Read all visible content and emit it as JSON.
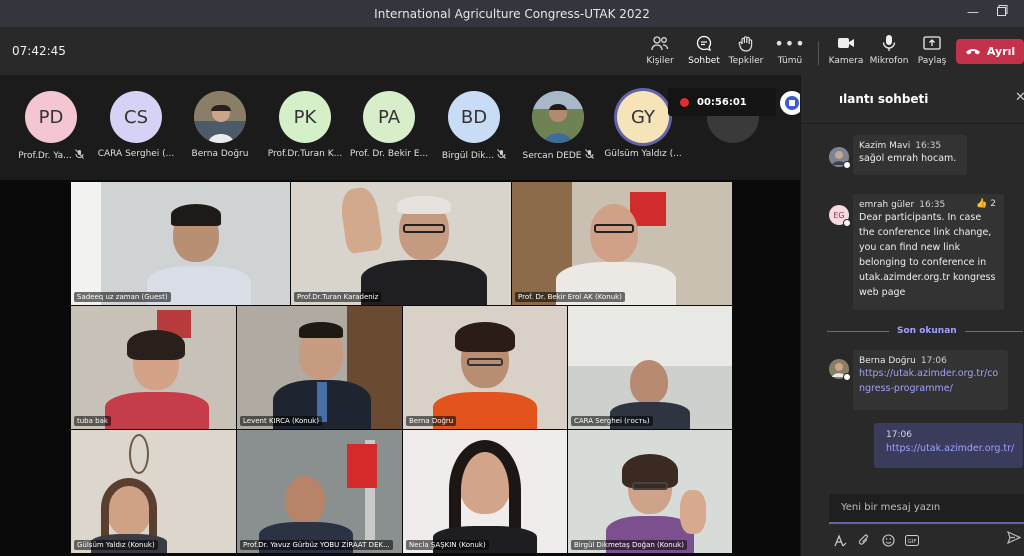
{
  "window": {
    "title": "International Agriculture Congress-UTAK 2022"
  },
  "toolbar": {
    "clock": "07:42:45",
    "people": "Kişiler",
    "chat": "Sohbet",
    "reactions": "Tepkiler",
    "more": "Tümü",
    "camera": "Kamera",
    "mic": "Mikrofon",
    "share": "Paylaş",
    "leave": "Ayrıl"
  },
  "recording": {
    "time": "00:56:01"
  },
  "participants": [
    {
      "initials": "PD",
      "name": "Prof.Dr. Ya...",
      "muted": true,
      "color": "#f3c6d1"
    },
    {
      "initials": "CS",
      "name": "CARA Serghei (...",
      "muted": false,
      "color": "#d6d2f5"
    },
    {
      "initials": "",
      "name": "Berna Doğru",
      "muted": false,
      "color": "#7a6f5a"
    },
    {
      "initials": "PK",
      "name": "Prof.Dr.Turan K...",
      "muted": false,
      "color": "#d5efc9"
    },
    {
      "initials": "PA",
      "name": "Prof. Dr. Bekir E...",
      "muted": false,
      "color": "#d8eecb"
    },
    {
      "initials": "BD",
      "name": "Birgül Dik...",
      "muted": true,
      "color": "#c9dcf6"
    },
    {
      "initials": "",
      "name": "Sercan DEDE",
      "muted": true,
      "color": "#5d6a4a"
    },
    {
      "initials": "GY",
      "name": "Gülsüm Yaldız (...",
      "muted": false,
      "color": "#f6e3b8"
    }
  ],
  "tiles": [
    {
      "label": "Sadeeq uz zaman (Guest)"
    },
    {
      "label": "Prof.Dr.Turan Karadeniz"
    },
    {
      "label": "Prof. Dr. Bekir Erol AK (Konuk)"
    },
    {
      "label": "tuba bak"
    },
    {
      "label": "Levent KIRCA (Konuk)"
    },
    {
      "label": "Berna Doğru"
    },
    {
      "label": "CARA Serghei (гость)"
    },
    {
      "label": "Gülsüm Yaldız (Konuk)"
    },
    {
      "label": "Prof.Dr. Yavuz Gürbüz YOBU ZİRAAT DEK..."
    },
    {
      "label": "Necla ŞAŞKIN (Konuk)"
    },
    {
      "label": "Birgül Dikmetaş Doğan (Konuk)"
    }
  ],
  "chat": {
    "title": "ılantı sohbeti",
    "messages": [
      {
        "author": "Kazim Mavi",
        "time": "16:35",
        "text": "sağol emrah hocam."
      },
      {
        "author": "emrah güler",
        "time": "16:35",
        "initials": "EG",
        "reaction_count": "2",
        "text": "Dear participants. In case the conference link change, you can find new link belonging to conference in utak.azimder.org.tr kongress web page"
      },
      {
        "author": "Berna Doğru",
        "time": "17:06",
        "link": "https://utak.azimder.org.tr/congress-programme/"
      }
    ],
    "last_read": "Son okunan",
    "own_message": {
      "time": "17:06",
      "link": "https://utak.azimder.org.tr/"
    },
    "compose_placeholder": "Yeni bir mesaj yazın"
  }
}
